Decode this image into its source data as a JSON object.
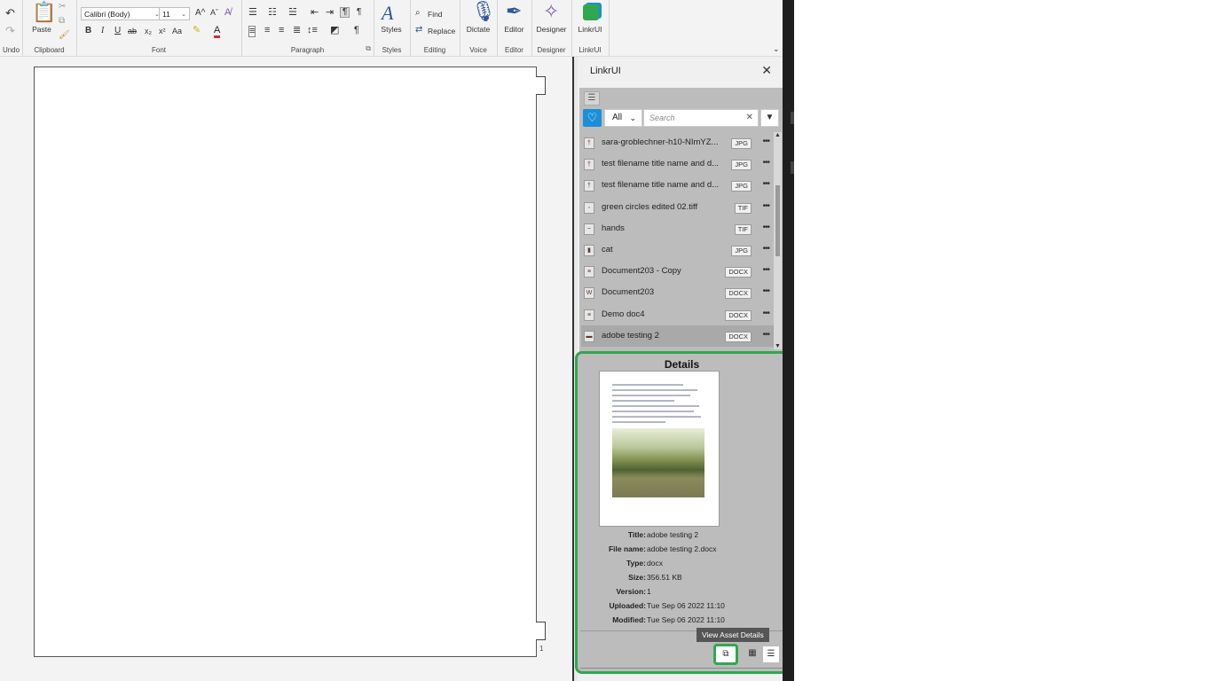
{
  "ribbon": {
    "groups": {
      "undo": "Undo",
      "clipboard": "Clipboard",
      "font": "Font",
      "paragraph": "Paragraph",
      "styles": "Styles",
      "editing": "Editing",
      "voice": "Voice",
      "editor": "Editor",
      "designer": "Designer",
      "linkrui": "LinkrUI"
    },
    "paste_label": "Paste",
    "font_name": "Calibri (Body)",
    "font_size": "11",
    "styles_label": "Styles",
    "find_label": "Find",
    "replace_label": "Replace",
    "dictate_label": "Dictate",
    "editor_label": "Editor",
    "designer_label": "Designer",
    "linkrui_label": "LinkrUI",
    "format": {
      "bold": "B",
      "italic": "I",
      "underline": "U",
      "strike": "ab",
      "subscript": "x₂",
      "superscript": "x²",
      "change_case": "Aa",
      "font_color": "A",
      "grow": "A^",
      "shrink": "Aˇ"
    },
    "pilcrow": "¶"
  },
  "document": {
    "page_number": "1"
  },
  "pane": {
    "title": "LinkrUI",
    "close": "✕",
    "filter_all": "All",
    "search_placeholder": "Search",
    "search_clear": "✕",
    "files": [
      {
        "name": "sara-groblechner-h10-NImYZ...",
        "type": "JPG",
        "thumb": "†",
        "selected": false
      },
      {
        "name": "test filename title name and d...",
        "type": "JPG",
        "thumb": "†",
        "selected": false
      },
      {
        "name": "test filename title name and d...",
        "type": "JPG",
        "thumb": "†",
        "selected": false
      },
      {
        "name": "green circles edited 02.tiff",
        "type": "TIF",
        "thumb": "◦",
        "selected": false
      },
      {
        "name": "hands",
        "type": "TIF",
        "thumb": "~",
        "selected": false
      },
      {
        "name": "cat",
        "type": "JPG",
        "thumb": "▮",
        "selected": false
      },
      {
        "name": "Document203 - Copy",
        "type": "DOCX",
        "thumb": "≡",
        "selected": false
      },
      {
        "name": "Document203",
        "type": "DOCX",
        "thumb": "W",
        "selected": false
      },
      {
        "name": "Demo doc4",
        "type": "DOCX",
        "thumb": "≡",
        "selected": false
      },
      {
        "name": "adobe testing 2",
        "type": "DOCX",
        "thumb": "▬",
        "selected": true
      }
    ],
    "more_glyph": "•••"
  },
  "details": {
    "heading": "Details",
    "fields": {
      "title_k": "Title:",
      "title_v": "adobe testing 2",
      "filename_k": "File name:",
      "filename_v": "adobe testing 2.docx",
      "type_k": "Type:",
      "type_v": "docx",
      "size_k": "Size:",
      "size_v": "356.51 KB",
      "version_k": "Version:",
      "version_v": "1",
      "uploaded_k": "Uploaded:",
      "uploaded_v": "Tue Sep 06 2022 11:10",
      "modified_k": "Modified:",
      "modified_v": "Tue Sep 06 2022 11:10"
    },
    "tooltip": "View Asset Details"
  },
  "colors": {
    "highlight_green": "#2fa84f",
    "logo_blue": "#1a8fd8"
  }
}
